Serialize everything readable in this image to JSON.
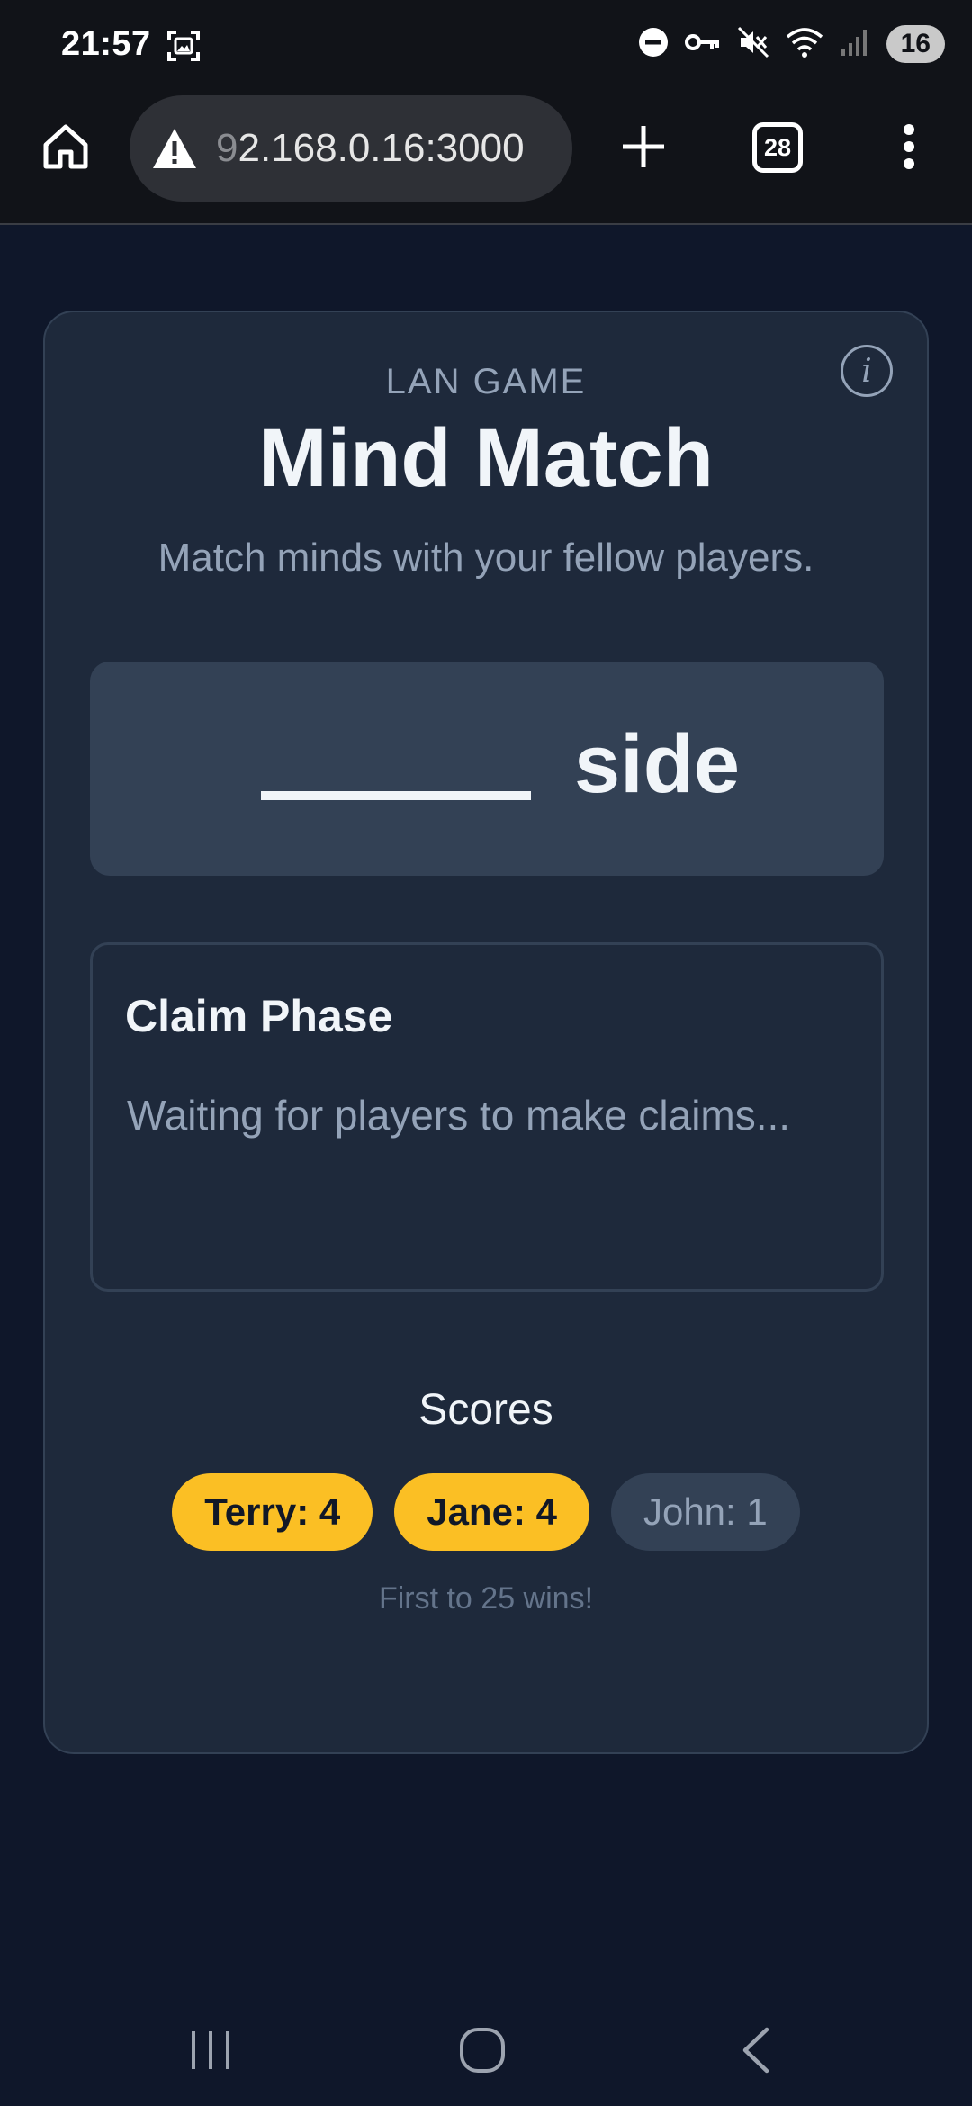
{
  "status_bar": {
    "time": "21:57",
    "battery": "16",
    "icons": [
      "screenshot-icon",
      "dnd-icon",
      "vpn-key-icon",
      "mute-icon",
      "wifi-icon",
      "signal-icon"
    ]
  },
  "browser": {
    "url_faded_prefix": "9",
    "url": "2.168.0.16:3000",
    "tab_count": "28",
    "icons": [
      "home-icon",
      "warning-icon",
      "plus-icon",
      "more-vert-icon"
    ]
  },
  "game": {
    "eyebrow": "LAN GAME",
    "title": "Mind Match",
    "subtitle": "Match minds with your fellow players.",
    "info_icon_glyph": "i",
    "prompt": {
      "word": "side"
    },
    "phase": {
      "title": "Claim Phase",
      "status": "Waiting for players to make claims..."
    },
    "scores": {
      "heading": "Scores",
      "players": [
        {
          "label": "Terry: 4",
          "leader": true
        },
        {
          "label": "Jane: 4",
          "leader": true
        },
        {
          "label": "John: 1",
          "leader": false
        }
      ],
      "win_note": "First to 25 wins!"
    },
    "colors": {
      "background": "#0f172a",
      "card": "#1e293b",
      "accent": "#fbbf24",
      "muted": "#94a3b8"
    }
  },
  "nav_bar": {
    "icons": [
      "recents-icon",
      "home-circle-icon",
      "back-icon"
    ]
  }
}
